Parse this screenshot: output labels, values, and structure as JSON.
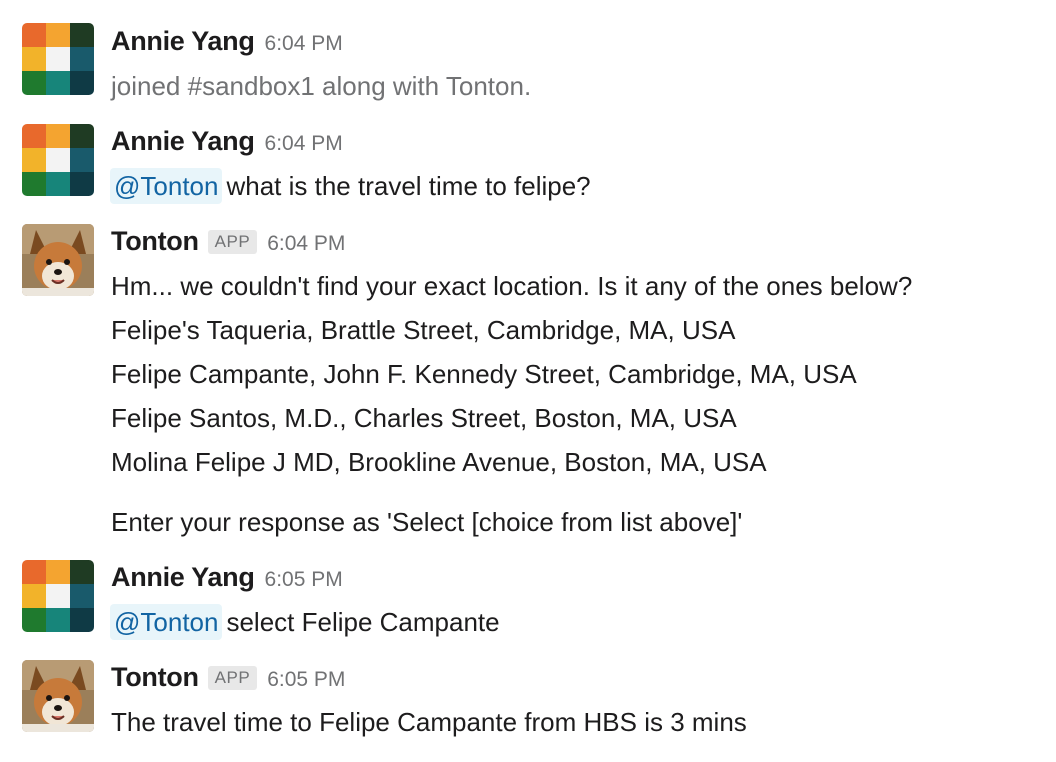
{
  "messages": [
    {
      "author": "Annie Yang",
      "time": "6:04 PM",
      "avatar_icon": "color-grid-avatar-icon",
      "lines": [
        "joined #sandbox1 along with Tonton."
      ]
    },
    {
      "author": "Annie Yang",
      "time": "6:04 PM",
      "avatar_icon": "color-grid-avatar-icon",
      "mention": "@Tonton",
      "text": "what is the travel time to felipe?"
    },
    {
      "author": "Tonton",
      "badge": "APP",
      "time": "6:04 PM",
      "avatar_icon": "shiba-dog-avatar-icon",
      "lines": [
        "Hm... we couldn't find your exact location. Is it any of the ones below?",
        "Felipe's Taqueria, Brattle Street, Cambridge, MA, USA",
        "Felipe Campante, John F. Kennedy Street, Cambridge, MA, USA",
        "Felipe Santos, M.D., Charles Street, Boston, MA, USA",
        "Molina Felipe J MD, Brookline Avenue, Boston, MA, USA",
        "Enter your response as 'Select [choice from list above]'"
      ]
    },
    {
      "author": "Annie Yang",
      "time": "6:05 PM",
      "avatar_icon": "color-grid-avatar-icon",
      "mention": "@Tonton",
      "text": "select Felipe Campante"
    },
    {
      "author": "Tonton",
      "badge": "APP",
      "time": "6:05 PM",
      "avatar_icon": "shiba-dog-avatar-icon",
      "lines": [
        "The travel time to Felipe Campante from HBS is 3 mins"
      ]
    }
  ],
  "colors": {
    "text": "#1d1c1d",
    "muted": "#717274",
    "mention_text": "#1264a3",
    "mention_bg": "#e8f5fa",
    "badge_bg": "#e8e8e8"
  }
}
